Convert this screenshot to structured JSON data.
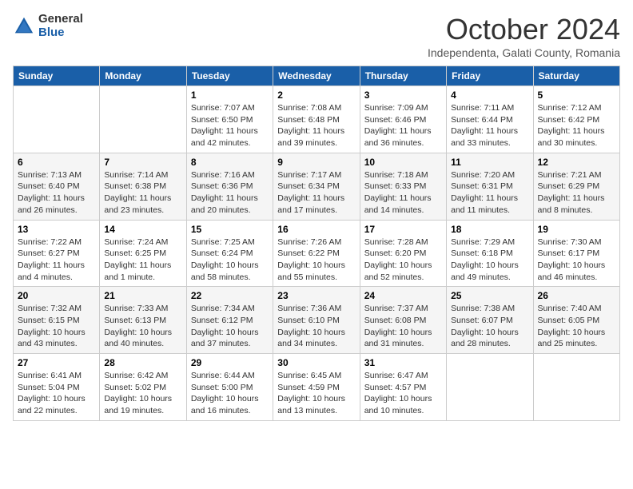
{
  "logo": {
    "general": "General",
    "blue": "Blue"
  },
  "title": "October 2024",
  "subtitle": "Independenta, Galati County, Romania",
  "days_header": [
    "Sunday",
    "Monday",
    "Tuesday",
    "Wednesday",
    "Thursday",
    "Friday",
    "Saturday"
  ],
  "weeks": [
    [
      {
        "day": "",
        "info": ""
      },
      {
        "day": "",
        "info": ""
      },
      {
        "day": "1",
        "info": "Sunrise: 7:07 AM\nSunset: 6:50 PM\nDaylight: 11 hours and 42 minutes."
      },
      {
        "day": "2",
        "info": "Sunrise: 7:08 AM\nSunset: 6:48 PM\nDaylight: 11 hours and 39 minutes."
      },
      {
        "day": "3",
        "info": "Sunrise: 7:09 AM\nSunset: 6:46 PM\nDaylight: 11 hours and 36 minutes."
      },
      {
        "day": "4",
        "info": "Sunrise: 7:11 AM\nSunset: 6:44 PM\nDaylight: 11 hours and 33 minutes."
      },
      {
        "day": "5",
        "info": "Sunrise: 7:12 AM\nSunset: 6:42 PM\nDaylight: 11 hours and 30 minutes."
      }
    ],
    [
      {
        "day": "6",
        "info": "Sunrise: 7:13 AM\nSunset: 6:40 PM\nDaylight: 11 hours and 26 minutes."
      },
      {
        "day": "7",
        "info": "Sunrise: 7:14 AM\nSunset: 6:38 PM\nDaylight: 11 hours and 23 minutes."
      },
      {
        "day": "8",
        "info": "Sunrise: 7:16 AM\nSunset: 6:36 PM\nDaylight: 11 hours and 20 minutes."
      },
      {
        "day": "9",
        "info": "Sunrise: 7:17 AM\nSunset: 6:34 PM\nDaylight: 11 hours and 17 minutes."
      },
      {
        "day": "10",
        "info": "Sunrise: 7:18 AM\nSunset: 6:33 PM\nDaylight: 11 hours and 14 minutes."
      },
      {
        "day": "11",
        "info": "Sunrise: 7:20 AM\nSunset: 6:31 PM\nDaylight: 11 hours and 11 minutes."
      },
      {
        "day": "12",
        "info": "Sunrise: 7:21 AM\nSunset: 6:29 PM\nDaylight: 11 hours and 8 minutes."
      }
    ],
    [
      {
        "day": "13",
        "info": "Sunrise: 7:22 AM\nSunset: 6:27 PM\nDaylight: 11 hours and 4 minutes."
      },
      {
        "day": "14",
        "info": "Sunrise: 7:24 AM\nSunset: 6:25 PM\nDaylight: 11 hours and 1 minute."
      },
      {
        "day": "15",
        "info": "Sunrise: 7:25 AM\nSunset: 6:24 PM\nDaylight: 10 hours and 58 minutes."
      },
      {
        "day": "16",
        "info": "Sunrise: 7:26 AM\nSunset: 6:22 PM\nDaylight: 10 hours and 55 minutes."
      },
      {
        "day": "17",
        "info": "Sunrise: 7:28 AM\nSunset: 6:20 PM\nDaylight: 10 hours and 52 minutes."
      },
      {
        "day": "18",
        "info": "Sunrise: 7:29 AM\nSunset: 6:18 PM\nDaylight: 10 hours and 49 minutes."
      },
      {
        "day": "19",
        "info": "Sunrise: 7:30 AM\nSunset: 6:17 PM\nDaylight: 10 hours and 46 minutes."
      }
    ],
    [
      {
        "day": "20",
        "info": "Sunrise: 7:32 AM\nSunset: 6:15 PM\nDaylight: 10 hours and 43 minutes."
      },
      {
        "day": "21",
        "info": "Sunrise: 7:33 AM\nSunset: 6:13 PM\nDaylight: 10 hours and 40 minutes."
      },
      {
        "day": "22",
        "info": "Sunrise: 7:34 AM\nSunset: 6:12 PM\nDaylight: 10 hours and 37 minutes."
      },
      {
        "day": "23",
        "info": "Sunrise: 7:36 AM\nSunset: 6:10 PM\nDaylight: 10 hours and 34 minutes."
      },
      {
        "day": "24",
        "info": "Sunrise: 7:37 AM\nSunset: 6:08 PM\nDaylight: 10 hours and 31 minutes."
      },
      {
        "day": "25",
        "info": "Sunrise: 7:38 AM\nSunset: 6:07 PM\nDaylight: 10 hours and 28 minutes."
      },
      {
        "day": "26",
        "info": "Sunrise: 7:40 AM\nSunset: 6:05 PM\nDaylight: 10 hours and 25 minutes."
      }
    ],
    [
      {
        "day": "27",
        "info": "Sunrise: 6:41 AM\nSunset: 5:04 PM\nDaylight: 10 hours and 22 minutes."
      },
      {
        "day": "28",
        "info": "Sunrise: 6:42 AM\nSunset: 5:02 PM\nDaylight: 10 hours and 19 minutes."
      },
      {
        "day": "29",
        "info": "Sunrise: 6:44 AM\nSunset: 5:00 PM\nDaylight: 10 hours and 16 minutes."
      },
      {
        "day": "30",
        "info": "Sunrise: 6:45 AM\nSunset: 4:59 PM\nDaylight: 10 hours and 13 minutes."
      },
      {
        "day": "31",
        "info": "Sunrise: 6:47 AM\nSunset: 4:57 PM\nDaylight: 10 hours and 10 minutes."
      },
      {
        "day": "",
        "info": ""
      },
      {
        "day": "",
        "info": ""
      }
    ]
  ]
}
